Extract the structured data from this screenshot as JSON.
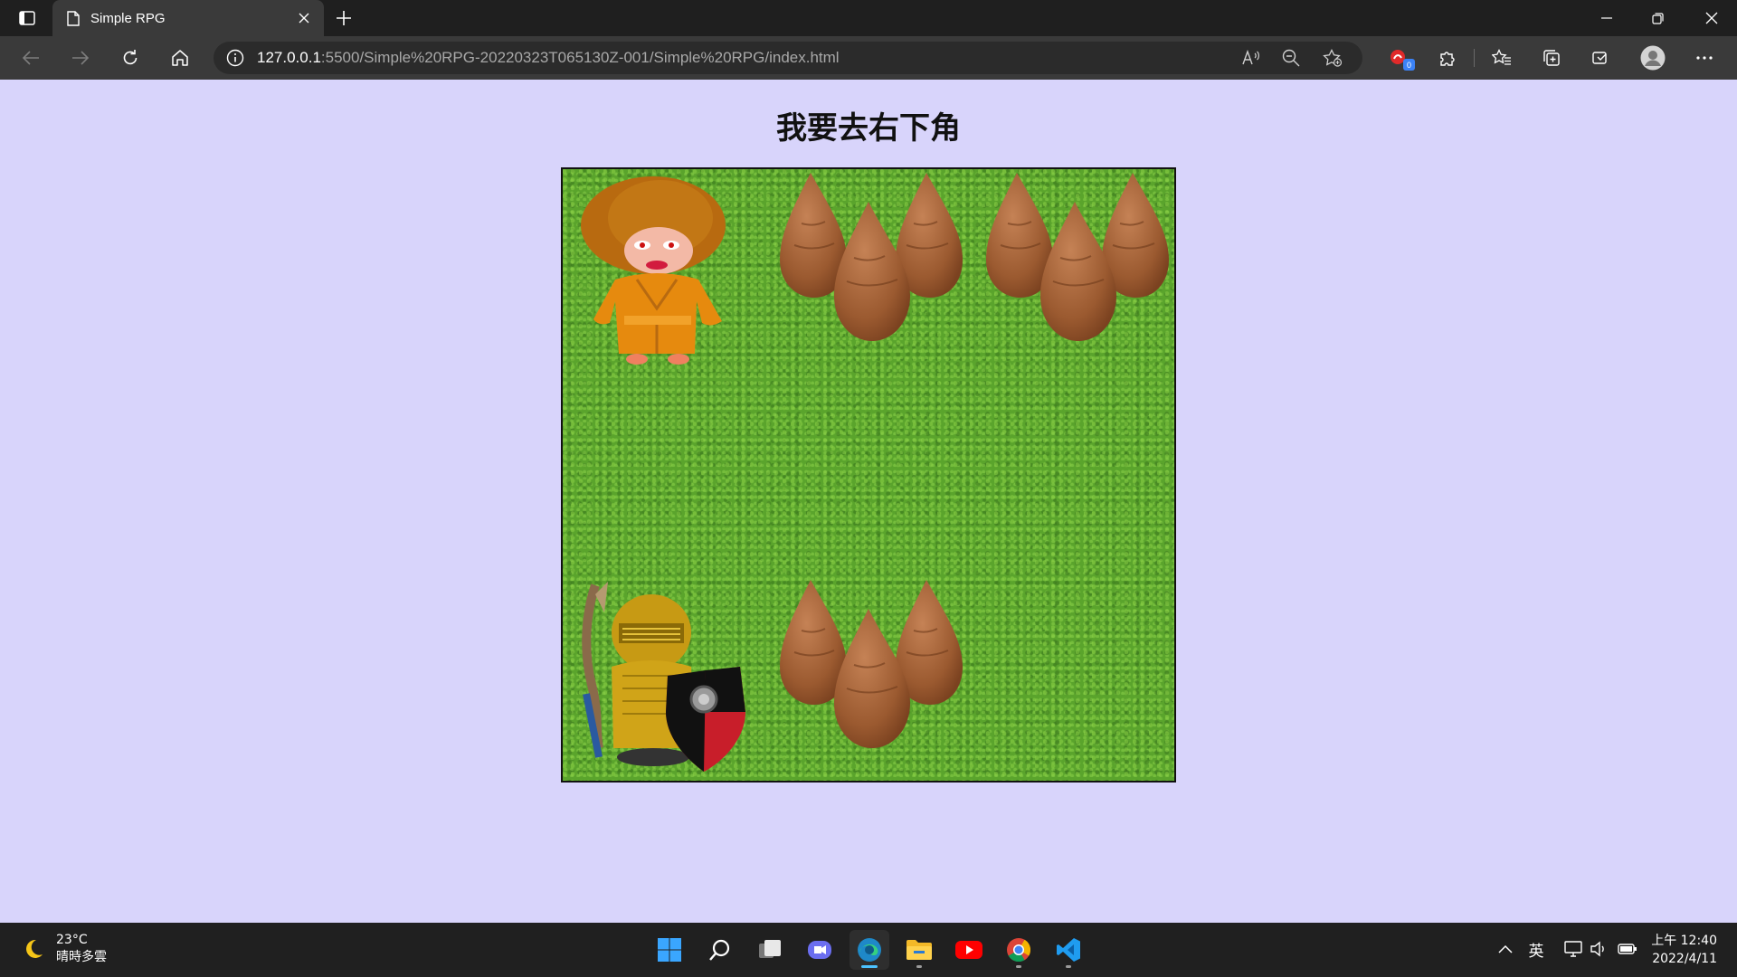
{
  "browser": {
    "tab_title": "Simple RPG",
    "url_host": "127.0.0.1",
    "url_path": ":5500/Simple%20RPG-20220323T065130Z-001/Simple%20RPG/index.html",
    "notification_count": "0"
  },
  "page": {
    "title": "我要去右下角"
  },
  "game": {
    "sprites": [
      "npc-monk",
      "tree-cluster",
      "tree-cluster",
      "knight-hero",
      "tree-cluster"
    ]
  },
  "taskbar": {
    "weather_temp": "23°C",
    "weather_desc": "晴時多雲",
    "ime_label": "英",
    "time": "上午 12:40",
    "date": "2022/4/11"
  },
  "colors": {
    "page_bg": "#d8d4fb",
    "grass": "#5aa42c",
    "accent": "#4cc2ff"
  }
}
